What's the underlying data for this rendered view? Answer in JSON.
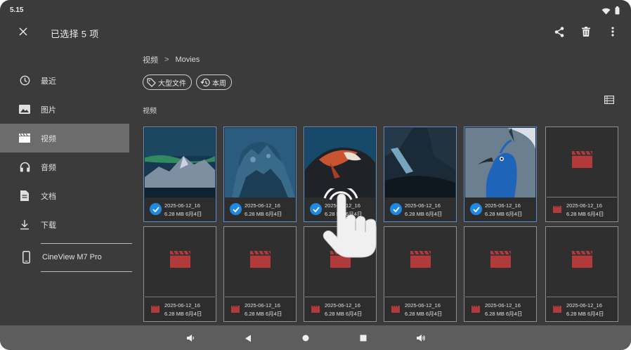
{
  "status": {
    "time": "5.15"
  },
  "topbar": {
    "title": "已选择 5 项"
  },
  "sidebar": {
    "items": [
      {
        "label": "最近",
        "icon": "clock-icon"
      },
      {
        "label": "图片",
        "icon": "image-icon"
      },
      {
        "label": "视频",
        "icon": "video-icon",
        "active": true
      },
      {
        "label": "音频",
        "icon": "headphones-icon"
      },
      {
        "label": "文档",
        "icon": "document-icon"
      },
      {
        "label": "下载",
        "icon": "download-icon"
      }
    ],
    "device": {
      "label": "CineView M7 Pro",
      "icon": "phone-icon"
    }
  },
  "breadcrumb": {
    "root": "视频",
    "separator": ">",
    "current": "Movies"
  },
  "chips": [
    {
      "label": "大型文件",
      "icon": "tag-icon"
    },
    {
      "label": "本周",
      "icon": "history-icon"
    }
  ],
  "section": {
    "label": "视频"
  },
  "files": [
    {
      "date": "2025-06-12_16",
      "size": "6.28 MB 6月4日",
      "selected": true,
      "thumb": "aurora"
    },
    {
      "date": "2025-06-12_16",
      "size": "6.28 MB 6月4日",
      "selected": true,
      "thumb": "coral"
    },
    {
      "date": "2025-06-12_16",
      "size": "6.28 MB 6月4日",
      "selected": true,
      "thumb": "fish"
    },
    {
      "date": "2025-06-12_16",
      "size": "6.28 MB 6月4日",
      "selected": true,
      "thumb": "cave"
    },
    {
      "date": "2025-06-12_16",
      "size": "6.28 MB 6月4日",
      "selected": true,
      "thumb": "peacock"
    },
    {
      "date": "2025-06-12_16",
      "size": "6.28 MB 6月4日",
      "selected": false,
      "thumb": "none"
    },
    {
      "date": "2025-06-12_16",
      "size": "6.28 MB 6月4日",
      "selected": false,
      "thumb": "none"
    },
    {
      "date": "2025-06-12_16",
      "size": "6.28 MB 6月4日",
      "selected": false,
      "thumb": "none"
    },
    {
      "date": "2025-06-12_16",
      "size": "6.28 MB 6月4日",
      "selected": false,
      "thumb": "none"
    },
    {
      "date": "2025-06-12_16",
      "size": "6.28 MB 6月4日",
      "selected": false,
      "thumb": "none"
    },
    {
      "date": "2025-06-12_16",
      "size": "6.28 MB 6月4日",
      "selected": false,
      "thumb": "none"
    },
    {
      "date": "2025-06-12_16",
      "size": "6.28 MB 6月4日",
      "selected": false,
      "thumb": "none"
    }
  ],
  "colors": {
    "background": "#3b3b3b",
    "sidebar_active": "#6c6c6c",
    "selection_accent": "#1e88e5",
    "video_placeholder": "#b33a3a",
    "navbar": "#5d5d5d"
  }
}
